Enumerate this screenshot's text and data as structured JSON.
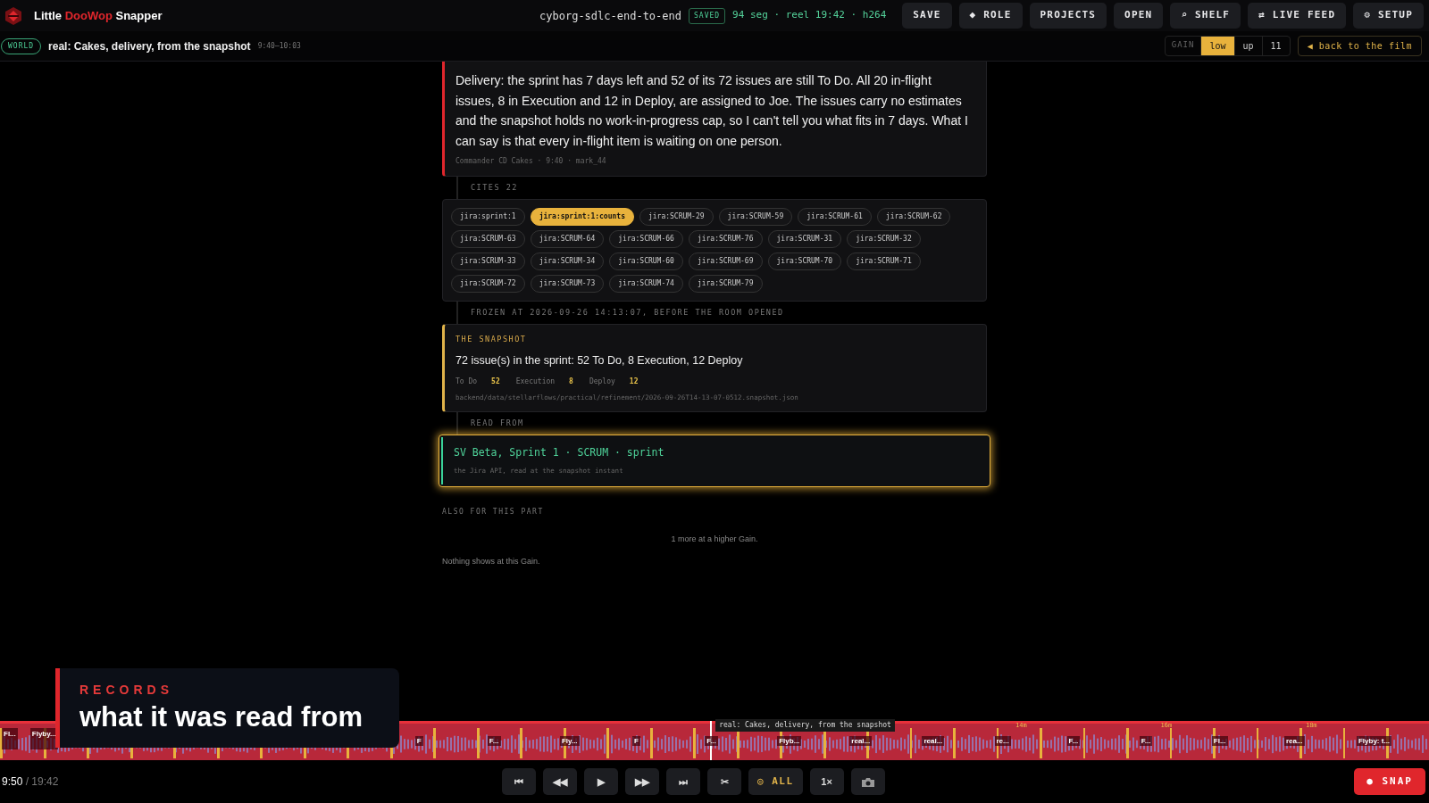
{
  "brand": {
    "before": "Little",
    "accent": "DooWop",
    "after": "Snapper"
  },
  "project": {
    "name": "cyborg-sdlc-end-to-end",
    "saved_badge": "SAVED",
    "info": "94 seg · reel 19:42 · h264"
  },
  "toolbar": [
    "SAVE",
    "◆ ROLE",
    "PROJECTS",
    "OPEN",
    "⌕ SHELF",
    "⇄ LIVE FEED",
    "⚙ SETUP"
  ],
  "world_bar": {
    "badge": "WORLD",
    "title": "real: Cakes, delivery, from the snapshot",
    "time": "9:40–10:03",
    "gain": {
      "label": "GAIN",
      "options": [
        {
          "label": "low",
          "selected": true
        },
        {
          "label": "up",
          "selected": false
        },
        {
          "label": "11",
          "selected": false
        }
      ]
    },
    "back": "◀ back to the film"
  },
  "message": {
    "text": "Delivery: the sprint has 7 days left and 52 of its 72 issues are still To Do. All 20 in-flight issues, 8 in Execution and 12 in Deploy, are assigned to Joe. The issues carry no estimates and the snapshot holds no work-in-progress cap, so I can't tell you what fits in 7 days. What I can say is that every in-flight item is waiting on one person.",
    "meta": "Commander CD Cakes · 9:40 · mark_44"
  },
  "cites": {
    "label": "CITES 22",
    "chips": [
      {
        "label": "jira:sprint:1",
        "selected": false
      },
      {
        "label": "jira:sprint:1:counts",
        "selected": true
      },
      {
        "label": "jira:SCRUM-29",
        "selected": false
      },
      {
        "label": "jira:SCRUM-59",
        "selected": false
      },
      {
        "label": "jira:SCRUM-61",
        "selected": false
      },
      {
        "label": "jira:SCRUM-62",
        "selected": false
      },
      {
        "label": "jira:SCRUM-63",
        "selected": false
      },
      {
        "label": "jira:SCRUM-64",
        "selected": false
      },
      {
        "label": "jira:SCRUM-66",
        "selected": false
      },
      {
        "label": "jira:SCRUM-76",
        "selected": false
      },
      {
        "label": "jira:SCRUM-31",
        "selected": false
      },
      {
        "label": "jira:SCRUM-32",
        "selected": false
      },
      {
        "label": "jira:SCRUM-33",
        "selected": false
      },
      {
        "label": "jira:SCRUM-34",
        "selected": false
      },
      {
        "label": "jira:SCRUM-60",
        "selected": false
      },
      {
        "label": "jira:SCRUM-69",
        "selected": false
      },
      {
        "label": "jira:SCRUM-70",
        "selected": false
      },
      {
        "label": "jira:SCRUM-71",
        "selected": false
      },
      {
        "label": "jira:SCRUM-72",
        "selected": false
      },
      {
        "label": "jira:SCRUM-73",
        "selected": false
      },
      {
        "label": "jira:SCRUM-74",
        "selected": false
      },
      {
        "label": "jira:SCRUM-79",
        "selected": false
      }
    ]
  },
  "frozen_label": "FROZEN AT 2026-09-26 14:13:07, BEFORE THE ROOM OPENED",
  "snapshot": {
    "heading": "THE SNAPSHOT",
    "summary": "72 issue(s) in the sprint: 52 To Do, 8 Execution, 12 Deploy",
    "stats": [
      {
        "label": "To Do",
        "value": "52"
      },
      {
        "label": "Execution",
        "value": "8"
      },
      {
        "label": "Deploy",
        "value": "12"
      }
    ],
    "path": "backend/data/stellarflows/practical/refinement/2026-09-26T14-13-07-0512.snapshot.json"
  },
  "read_from_label": "READ FROM",
  "source": {
    "title": "SV Beta, Sprint 1 · SCRUM · sprint",
    "subtitle": "the Jira API, read at the snapshot instant",
    "highlighted": true
  },
  "also": {
    "heading": "ALSO FOR THIS PART",
    "more": "1 more at a higher Gain.",
    "empty": "Nothing shows at this Gain."
  },
  "caption": {
    "kicker": "RECORDS",
    "title": "what it was read from"
  },
  "timeline": {
    "tooltip": "real: Cakes, delivery, from the snapshot",
    "level": 0.497,
    "ticks": [
      "14m",
      "16m",
      "18m"
    ],
    "segments_left": [
      "Fl...",
      "Flyby..."
    ],
    "segments": [
      "F",
      "F...",
      "Fly...",
      "F",
      "F...",
      "Flyb...",
      "real...",
      "real...",
      "re...",
      "F...",
      "F...",
      "Fl...",
      "rea...",
      "Flyby: t..."
    ]
  },
  "player": {
    "current": "9:50",
    "total": "/ 19:42",
    "controls": [
      "⏮",
      "◀◀",
      "▶",
      "▶▶",
      "⏭",
      "✂"
    ],
    "filter": "◎ ALL",
    "speed": "1×",
    "snap": "● SNAP"
  }
}
